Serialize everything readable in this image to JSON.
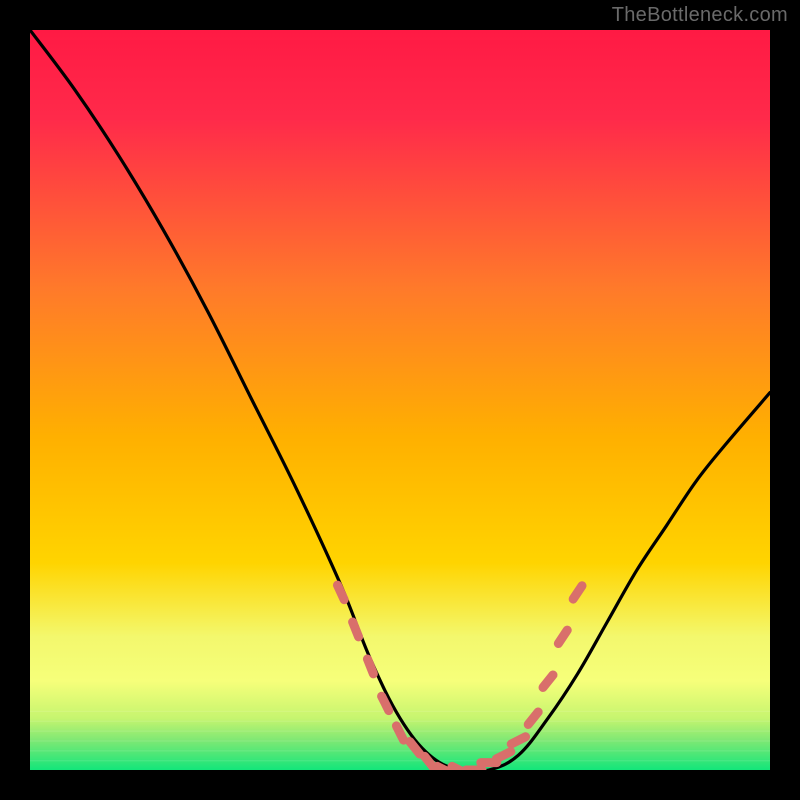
{
  "watermark": "TheBottleneck.com",
  "chart_data": {
    "type": "line",
    "title": "",
    "xlabel": "",
    "ylabel": "",
    "xlim": [
      0,
      100
    ],
    "ylim": [
      0,
      100
    ],
    "background_gradient": {
      "top_color": "#ff1a44",
      "mid_color": "#ffd400",
      "bottom_color": "#13e67a"
    },
    "bottom_band_color": "#f6ff7a",
    "curve_color": "#000000",
    "marker_color": "#d96f6b",
    "series": [
      {
        "name": "bottleneck-curve",
        "x": [
          0,
          6,
          12,
          18,
          24,
          30,
          36,
          42,
          46,
          50,
          54,
          58,
          62,
          66,
          70,
          74,
          78,
          82,
          86,
          90,
          94,
          100
        ],
        "y": [
          100,
          92,
          83,
          73,
          62,
          50,
          38,
          25,
          15,
          7,
          2,
          0,
          0,
          2,
          7,
          13,
          20,
          27,
          33,
          39,
          44,
          51
        ]
      }
    ],
    "markers": [
      {
        "x": 42,
        "y": 24
      },
      {
        "x": 44,
        "y": 19
      },
      {
        "x": 46,
        "y": 14
      },
      {
        "x": 48,
        "y": 9
      },
      {
        "x": 50,
        "y": 5
      },
      {
        "x": 52,
        "y": 3
      },
      {
        "x": 54,
        "y": 1
      },
      {
        "x": 56,
        "y": 0
      },
      {
        "x": 58,
        "y": 0
      },
      {
        "x": 60,
        "y": 0
      },
      {
        "x": 62,
        "y": 1
      },
      {
        "x": 64,
        "y": 2
      },
      {
        "x": 66,
        "y": 4
      },
      {
        "x": 68,
        "y": 7
      },
      {
        "x": 70,
        "y": 12
      },
      {
        "x": 72,
        "y": 18
      },
      {
        "x": 74,
        "y": 24
      }
    ]
  }
}
